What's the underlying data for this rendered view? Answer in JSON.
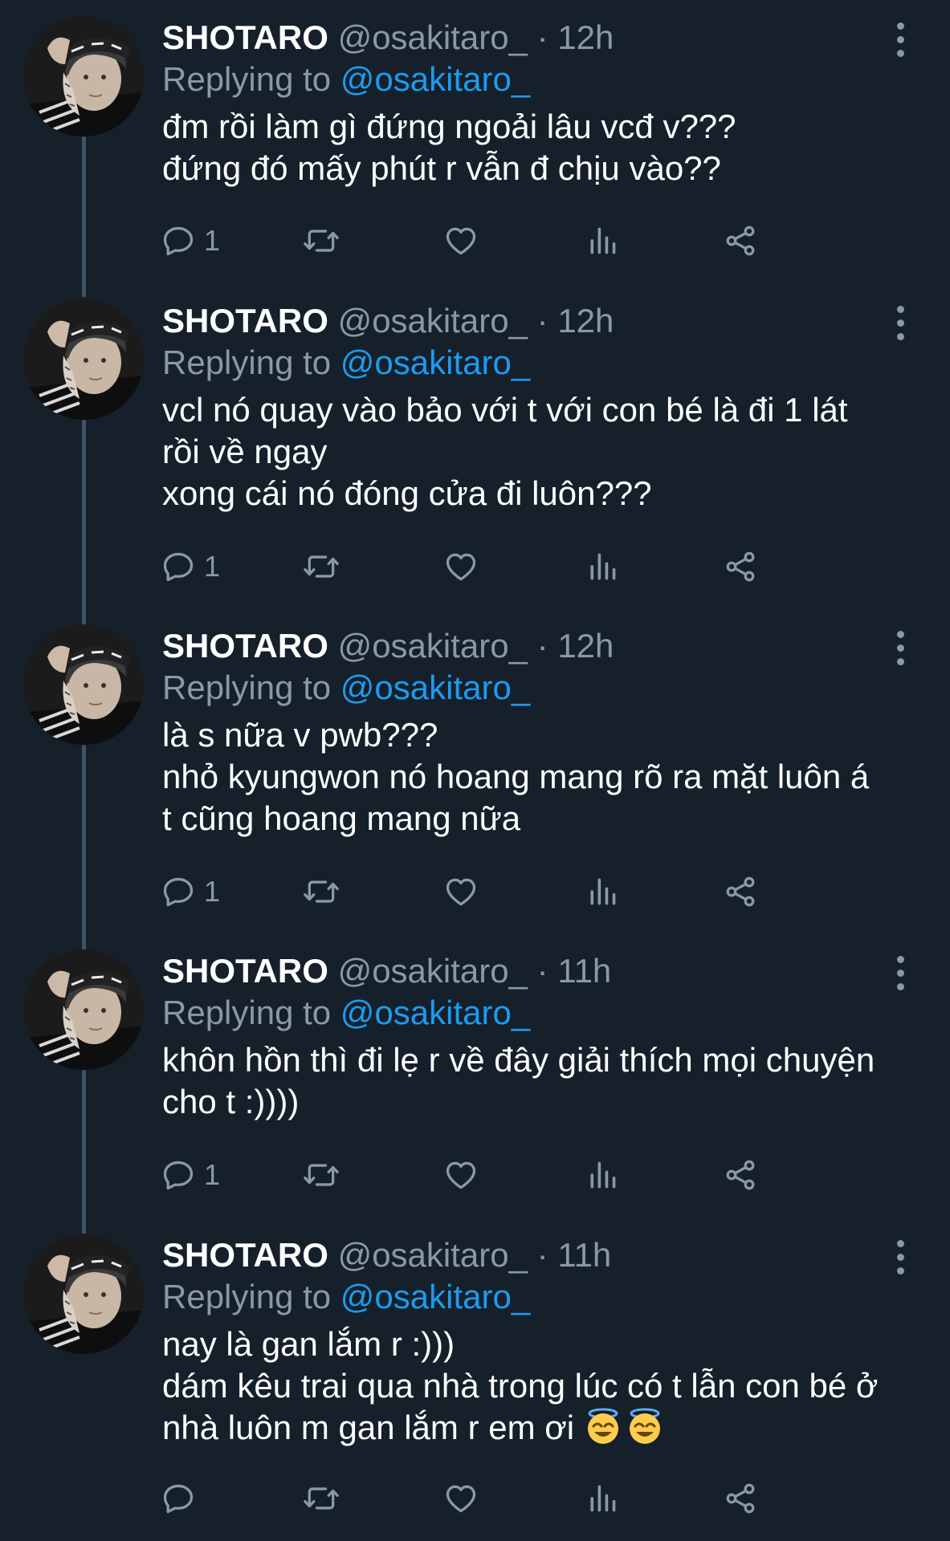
{
  "tweets": [
    {
      "name": "SHOTARO",
      "handle": "@osakitaro_",
      "dot": "·",
      "time": "12h",
      "replying_prefix": "Replying to",
      "replying_handle": "@osakitaro_",
      "lines": [
        "đm rồi làm gì đứng ngoải lâu vcđ v???",
        "đứng đó mấy phút r vẫn đ chịu vào??"
      ],
      "reply_count": "1"
    },
    {
      "name": "SHOTARO",
      "handle": "@osakitaro_",
      "dot": "·",
      "time": "12h",
      "replying_prefix": "Replying to",
      "replying_handle": "@osakitaro_",
      "lines": [
        "vcl nó quay vào bảo với t với con bé là đi 1 lát",
        "rồi về ngay",
        "xong cái nó đóng cửa đi luôn???"
      ],
      "reply_count": "1"
    },
    {
      "name": "SHOTARO",
      "handle": "@osakitaro_",
      "dot": "·",
      "time": "12h",
      "replying_prefix": "Replying to",
      "replying_handle": "@osakitaro_",
      "lines": [
        "là s nữa v pwb???",
        "nhỏ kyungwon nó hoang mang rõ ra mặt luôn á",
        "t cũng hoang mang nữa"
      ],
      "reply_count": "1"
    },
    {
      "name": "SHOTARO",
      "handle": "@osakitaro_",
      "dot": "·",
      "time": "11h",
      "replying_prefix": "Replying to",
      "replying_handle": "@osakitaro_",
      "lines": [
        "khôn hồn thì đi lẹ r về đây giải thích mọi chuyện",
        "cho t :))))"
      ],
      "reply_count": "1"
    },
    {
      "name": "SHOTARO",
      "handle": "@osakitaro_",
      "dot": "·",
      "time": "11h",
      "replying_prefix": "Replying to",
      "replying_handle": "@osakitaro_",
      "lines": [
        "nay là gan lắm r :)))",
        "dám kêu trai qua nhà trong lúc có t lẫn con bé ở",
        "nhà luôn m gan lắm r em ơi"
      ],
      "reply_count": "",
      "trailing_emoji": [
        "smiling-face-with-halo",
        "smiling-face-with-halo"
      ]
    }
  ],
  "icons": {
    "reply": "reply-icon",
    "retweet": "retweet-icon",
    "like": "like-icon",
    "views": "views-icon",
    "share": "share-icon",
    "more": "more-icon"
  },
  "colors": {
    "background": "#15202b",
    "secondary_text": "#8b98a5",
    "mention": "#1d9bf0",
    "thread_line": "#3d5466"
  }
}
